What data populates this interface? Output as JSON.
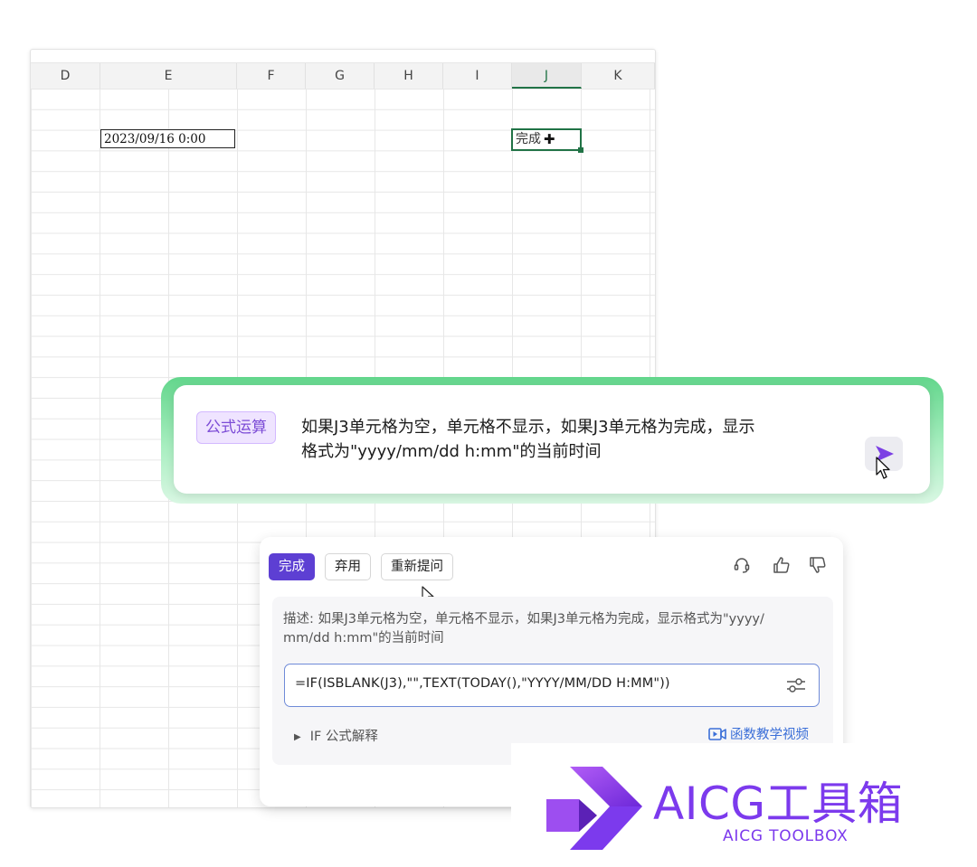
{
  "sheet": {
    "columns": [
      "D",
      "E",
      "F",
      "G",
      "H",
      "I",
      "J",
      "K"
    ],
    "active_column": "J",
    "date_cell_value": "2023/09/16 0:00",
    "selected_cell_value": "完成"
  },
  "prompt": {
    "tag": "公式运算",
    "text_line1": "如果J3单元格为空，单元格不显示，如果J3单元格为完成，显示",
    "text_line2": "格式为\"yyyy/mm/dd h:mm\"的当前时间"
  },
  "result": {
    "buttons": {
      "done": "完成",
      "discard": "弃用",
      "reask": "重新提问"
    },
    "description_line1": "描述: 如果J3单元格为空，单元格不显示，如果J3单元格为完成，显示格式为\"yyyy/",
    "description_line2": "mm/dd h:mm\"的当前时间",
    "formula": "=IF(ISBLANK(J3),\"\",TEXT(TODAY(),\"YYYY/MM/DD H:MM\"))",
    "explain_label": "IF 公式解释",
    "video_link": "函数教学视频"
  },
  "branding": {
    "title": "AICG工具箱",
    "subtitle": "AICG TOOLBOX",
    "color": "#7c3aed"
  },
  "colors": {
    "excel_green": "#217346",
    "primary_purple": "#5d3fd3",
    "tag_purple": "#7c4cd6",
    "glow_green": "#63d68c",
    "link_blue": "#3b6fd8"
  }
}
